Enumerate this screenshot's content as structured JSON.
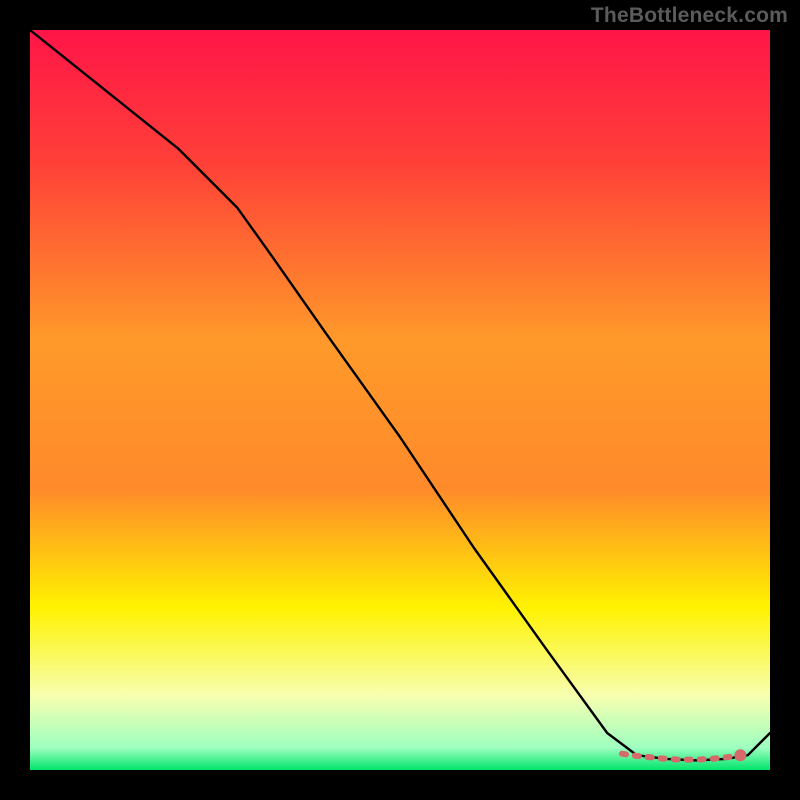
{
  "watermark": "TheBottleneck.com",
  "chart_data": {
    "type": "line",
    "title": "",
    "xlabel": "",
    "ylabel": "",
    "xlim": [
      0,
      100
    ],
    "ylim": [
      0,
      100
    ],
    "grid": false,
    "legend": false,
    "background_gradient": {
      "top": "#ff1548",
      "mid_high": "#ff8a2a",
      "mid": "#fff200",
      "low": "#f7ffb0",
      "bottom": "#00e56b"
    },
    "series": [
      {
        "name": "curve",
        "stroke": "#000000",
        "x": [
          0,
          5,
          10,
          15,
          20,
          25,
          28,
          33,
          40,
          50,
          60,
          70,
          78,
          82,
          86,
          90,
          94,
          97,
          100
        ],
        "y": [
          100,
          96,
          92,
          88,
          84,
          79,
          76,
          69,
          59,
          45,
          30,
          16,
          5,
          2,
          1.5,
          1.3,
          1.5,
          2,
          5
        ]
      }
    ],
    "annotations": {
      "dashed_segment": {
        "stroke": "#d46a6a",
        "x": [
          80,
          82,
          84,
          86,
          88,
          90,
          92,
          94,
          96
        ],
        "y": [
          2.2,
          1.9,
          1.7,
          1.5,
          1.4,
          1.4,
          1.5,
          1.7,
          2.0
        ]
      },
      "marker_point": {
        "x": 96,
        "y": 2.0,
        "fill": "#d46a6a",
        "r": 6
      }
    }
  }
}
